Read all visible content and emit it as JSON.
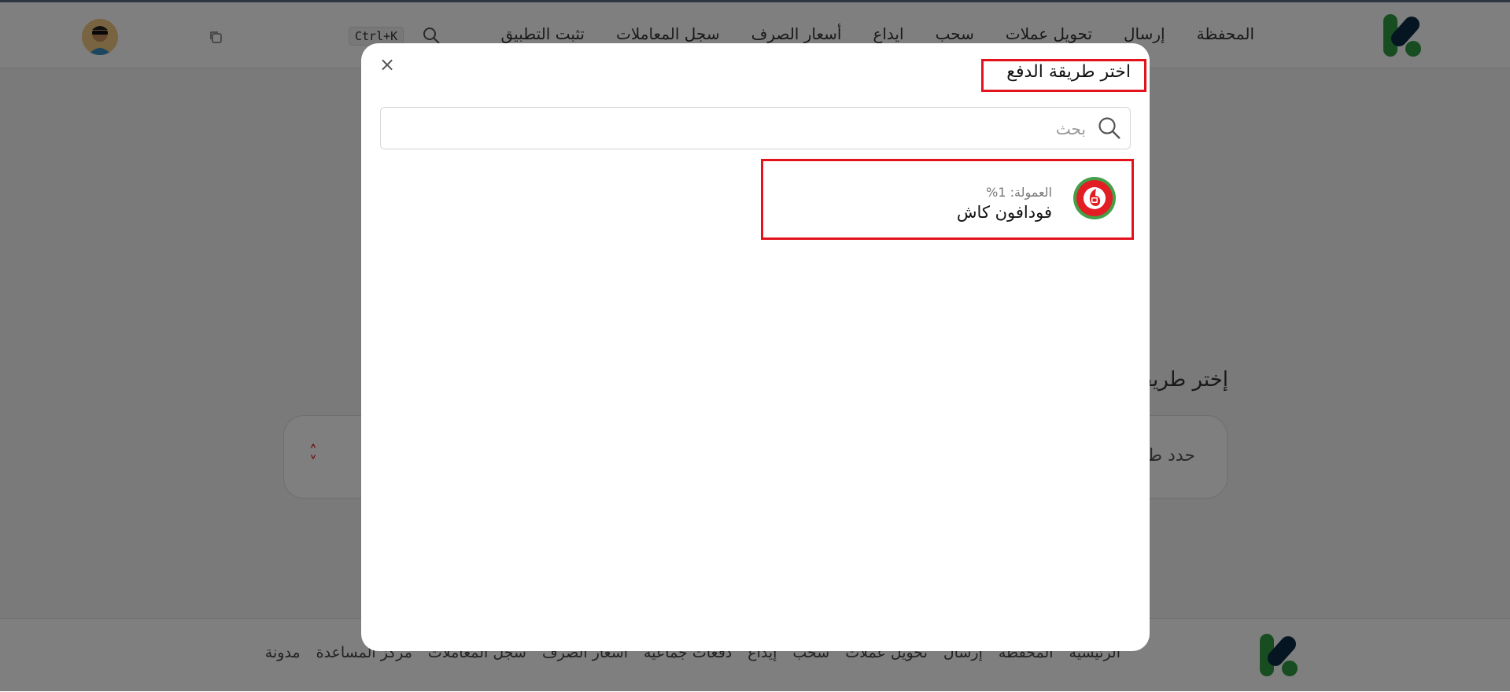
{
  "header": {
    "nav": [
      "المحفظة",
      "إرسال",
      "تحويل عملات",
      "سحب",
      "ايداع",
      "أسعار الصرف",
      "سجل المعاملات",
      "تثبت التطبيق"
    ],
    "search_shortcut": "Ctrl+K"
  },
  "page": {
    "choose_label": "إختر طريقة الدفع",
    "select_placeholder": "حدد طريقة الدفع"
  },
  "footer": {
    "links": [
      "الرئيسية",
      "المحفظة",
      "إرسال",
      "تحويل عملات",
      "سحب",
      "إيداع",
      "دفعات جماعية",
      "أسعار الصرف",
      "سجل المعاملات",
      "مركز المساعدة",
      "مدونة"
    ]
  },
  "modal": {
    "title": "اختر طريقة الدفع",
    "close_symbol": "×",
    "search_placeholder": "بحث",
    "search_value": "",
    "options": [
      {
        "name": "فودافون كاش",
        "fee": "العمولة: 1%",
        "icon": "vodafone-cash-logo"
      }
    ]
  },
  "colors": {
    "accent_red": "#e3131e",
    "brand_green": "#2e9a41",
    "brand_navy": "#0d2b45",
    "vodafone_red": "#e31d24"
  }
}
